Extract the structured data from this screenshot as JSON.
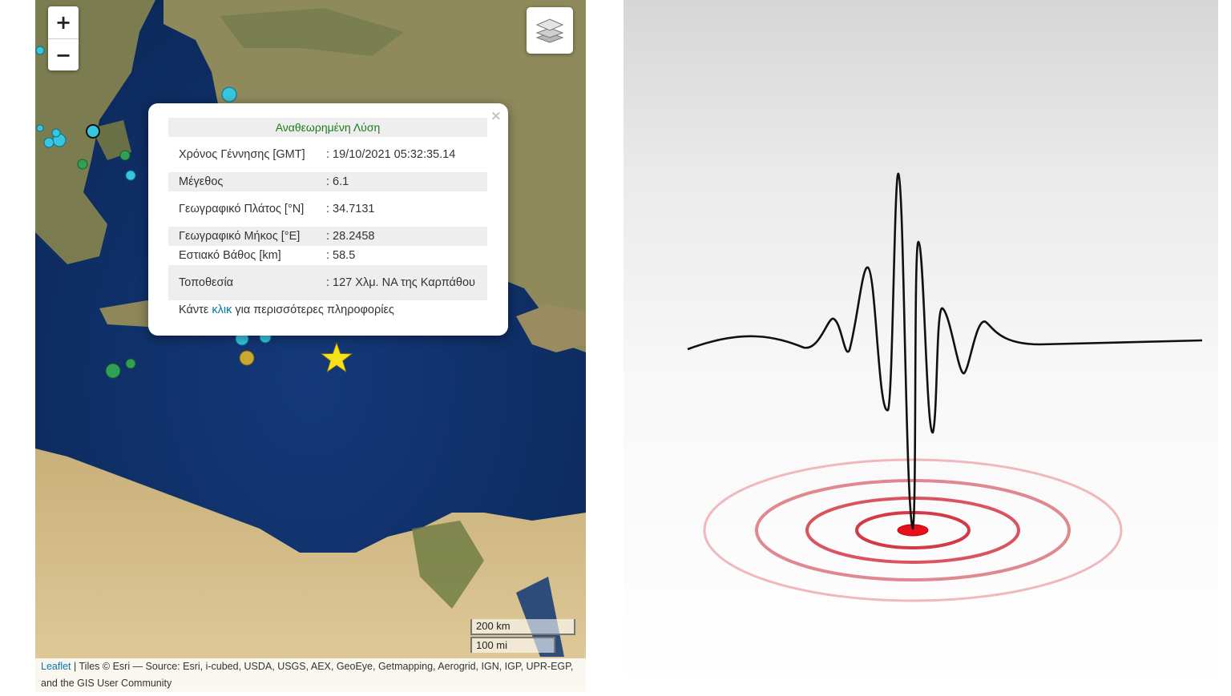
{
  "map": {
    "zoom_in_label": "+",
    "zoom_out_label": "−",
    "layers_icon": "layers-icon",
    "marker_icon": "star-icon",
    "popup": {
      "title": "Αναθεωρημένη Λύση",
      "close_label": "×",
      "rows": [
        {
          "label": "Χρόνος Γέννησης [GMT]",
          "value": ": 19/10/2021 05:32:35.14"
        },
        {
          "label": "Μέγεθος",
          "value": ": 6.1"
        },
        {
          "label": "Γεωγραφικό Πλάτος [°N]",
          "value": ": 34.7131"
        },
        {
          "label": "Γεωγραφικό Μήκος [°E]",
          "value": ": 28.2458"
        },
        {
          "label": "Εστιακό Βάθος [km]",
          "value": ": 58.5"
        },
        {
          "label": "Τοποθεσία",
          "value": ": 127 Χλμ. ΝΑ της Καρπάθου"
        }
      ],
      "footer_before": "Κάντε ",
      "footer_link": "κλικ",
      "footer_after": " για περισσότερες πληροφορίες"
    },
    "scale": {
      "km": "200 km",
      "mi": "100 mi"
    },
    "attribution": {
      "leaflet": "Leaflet",
      "text": " | Tiles © Esri — Source: Esri, i-cubed, USDA, USGS, AEX, GeoEye, Getmapping, Aerogrid, IGN, IGP, UPR-EGP, and the GIS User Community"
    },
    "colors": {
      "sea": "#0f2f66",
      "land": "#a9956a",
      "marker": "#f6e21a",
      "popup_title": "#1c7a1c",
      "link": "#0078a8"
    }
  },
  "illustration": {
    "icons": [
      "seismograph-wave",
      "epicenter-rings"
    ],
    "colors": {
      "wave": "#111111",
      "rings": "#d9454f",
      "center": "#e5101c"
    }
  }
}
